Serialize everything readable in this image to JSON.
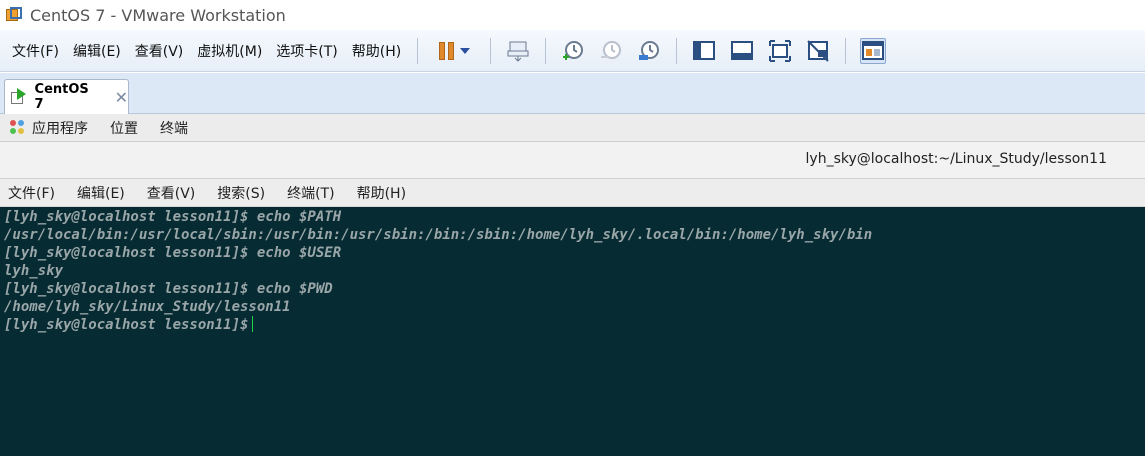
{
  "window": {
    "title": "CentOS 7 - VMware Workstation"
  },
  "menubar": {
    "items": [
      "文件(F)",
      "编辑(E)",
      "查看(V)",
      "虚拟机(M)",
      "选项卡(T)",
      "帮助(H)"
    ]
  },
  "toolbar": {
    "buttons": [
      "pause-icon",
      "send-ctrl-alt-del-icon",
      "snapshot-icon",
      "revert-snapshot-icon",
      "snapshot-manager-icon",
      "show-library-icon",
      "thumbnail-bar-icon",
      "fullscreen-icon",
      "unity-icon",
      "console-view-icon"
    ]
  },
  "tab": {
    "label": "CentOS 7",
    "close": "✕"
  },
  "gnome_bar": {
    "items": [
      "应用程序",
      "位置",
      "终端"
    ]
  },
  "terminal_window": {
    "title": "lyh_sky@localhost:~/Linux_Study/lesson11",
    "menu": [
      "文件(F)",
      "编辑(E)",
      "查看(V)",
      "搜索(S)",
      "终端(T)",
      "帮助(H)"
    ]
  },
  "terminal": {
    "lines": [
      "[lyh_sky@localhost lesson11]$ echo $PATH",
      "/usr/local/bin:/usr/local/sbin:/usr/bin:/usr/sbin:/bin:/sbin:/home/lyh_sky/.local/bin:/home/lyh_sky/bin",
      "[lyh_sky@localhost lesson11]$ echo $USER",
      "lyh_sky",
      "[lyh_sky@localhost lesson11]$ echo $PWD",
      "/home/lyh_sky/Linux_Study/lesson11",
      "[lyh_sky@localhost lesson11]$"
    ],
    "colors": {
      "background": "#062b33",
      "text": "#9aa6a8",
      "cursor": "#1ed04a"
    }
  }
}
